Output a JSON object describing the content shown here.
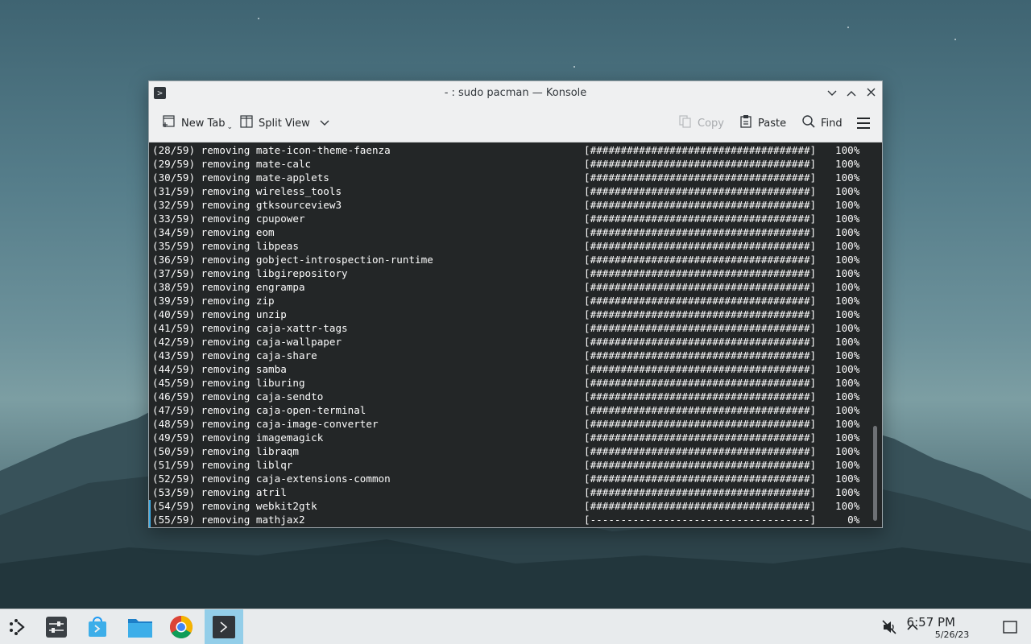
{
  "window": {
    "title": "- : sudo pacman — Konsole",
    "app_icon_glyph": ">",
    "controls": {
      "minimize": "⌄",
      "maximize": "⌃",
      "close": "✕"
    }
  },
  "toolbar": {
    "new_tab_label": "New Tab",
    "split_view_label": "Split View",
    "copy_label": "Copy",
    "paste_label": "Paste",
    "find_label": "Find"
  },
  "terminal": {
    "lines": [
      {
        "text": "(28/59) removing mate-icon-theme-faenza",
        "bar": "[####################################]",
        "pct": "100%"
      },
      {
        "text": "(29/59) removing mate-calc",
        "bar": "[####################################]",
        "pct": "100%"
      },
      {
        "text": "(30/59) removing mate-applets",
        "bar": "[####################################]",
        "pct": "100%"
      },
      {
        "text": "(31/59) removing wireless_tools",
        "bar": "[####################################]",
        "pct": "100%"
      },
      {
        "text": "(32/59) removing gtksourceview3",
        "bar": "[####################################]",
        "pct": "100%"
      },
      {
        "text": "(33/59) removing cpupower",
        "bar": "[####################################]",
        "pct": "100%"
      },
      {
        "text": "(34/59) removing eom",
        "bar": "[####################################]",
        "pct": "100%"
      },
      {
        "text": "(35/59) removing libpeas",
        "bar": "[####################################]",
        "pct": "100%"
      },
      {
        "text": "(36/59) removing gobject-introspection-runtime",
        "bar": "[####################################]",
        "pct": "100%"
      },
      {
        "text": "(37/59) removing libgirepository",
        "bar": "[####################################]",
        "pct": "100%"
      },
      {
        "text": "(38/59) removing engrampa",
        "bar": "[####################################]",
        "pct": "100%"
      },
      {
        "text": "(39/59) removing zip",
        "bar": "[####################################]",
        "pct": "100%"
      },
      {
        "text": "(40/59) removing unzip",
        "bar": "[####################################]",
        "pct": "100%"
      },
      {
        "text": "(41/59) removing caja-xattr-tags",
        "bar": "[####################################]",
        "pct": "100%"
      },
      {
        "text": "(42/59) removing caja-wallpaper",
        "bar": "[####################################]",
        "pct": "100%"
      },
      {
        "text": "(43/59) removing caja-share",
        "bar": "[####################################]",
        "pct": "100%"
      },
      {
        "text": "(44/59) removing samba",
        "bar": "[####################################]",
        "pct": "100%"
      },
      {
        "text": "(45/59) removing liburing",
        "bar": "[####################################]",
        "pct": "100%"
      },
      {
        "text": "(46/59) removing caja-sendto",
        "bar": "[####################################]",
        "pct": "100%"
      },
      {
        "text": "(47/59) removing caja-open-terminal",
        "bar": "[####################################]",
        "pct": "100%"
      },
      {
        "text": "(48/59) removing caja-image-converter",
        "bar": "[####################################]",
        "pct": "100%"
      },
      {
        "text": "(49/59) removing imagemagick",
        "bar": "[####################################]",
        "pct": "100%"
      },
      {
        "text": "(50/59) removing libraqm",
        "bar": "[####################################]",
        "pct": "100%"
      },
      {
        "text": "(51/59) removing liblqr",
        "bar": "[####################################]",
        "pct": "100%"
      },
      {
        "text": "(52/59) removing caja-extensions-common",
        "bar": "[####################################]",
        "pct": "100%"
      },
      {
        "text": "(53/59) removing atril",
        "bar": "[####################################]",
        "pct": "100%"
      },
      {
        "text": "(54/59) removing webkit2gtk",
        "bar": "[####################################]",
        "pct": "100%"
      },
      {
        "text": "(55/59) removing mathjax2",
        "bar": "[------------------------------------]",
        "pct": "  0%"
      }
    ]
  },
  "taskbar": {
    "clock_time": "6:57 PM",
    "clock_date": "5/26/23",
    "items": [
      {
        "name": "application-launcher-icon"
      },
      {
        "name": "system-settings-icon"
      },
      {
        "name": "discover-store-icon"
      },
      {
        "name": "dolphin-files-icon"
      },
      {
        "name": "chrome-browser-icon"
      },
      {
        "name": "konsole-terminal-icon",
        "active": true
      }
    ]
  },
  "colors": {
    "terminal_bg": "#232627",
    "terminal_fg": "#fcfcfc",
    "chrome_bg": "#eff0f1",
    "active_task": "#93cee9",
    "accent": "#3daee9"
  }
}
